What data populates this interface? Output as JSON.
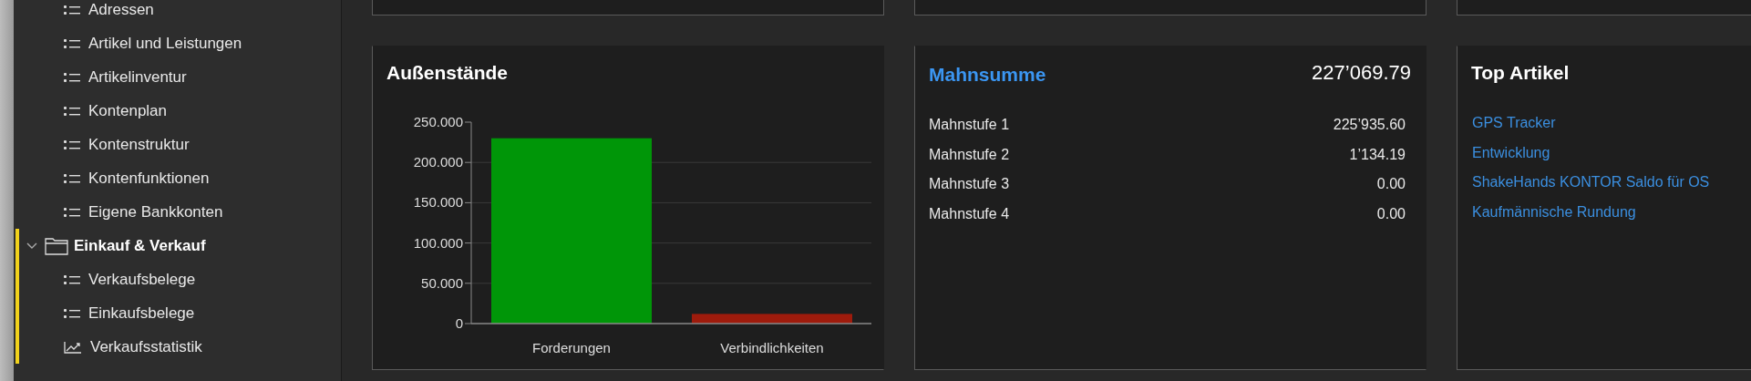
{
  "sidebar": {
    "items": [
      {
        "kind": "list",
        "label": "Adressen",
        "selected": false
      },
      {
        "kind": "list",
        "label": "Artikel und Leistungen",
        "selected": false
      },
      {
        "kind": "list",
        "label": "Artikelinventur",
        "selected": false
      },
      {
        "kind": "list",
        "label": "Kontenplan",
        "selected": false
      },
      {
        "kind": "list",
        "label": "Kontenstruktur",
        "selected": false
      },
      {
        "kind": "list",
        "label": "Kontenfunktionen",
        "selected": false
      },
      {
        "kind": "list",
        "label": "Eigene Bankkonten",
        "selected": false
      },
      {
        "kind": "folder",
        "label": "Einkauf & Verkauf",
        "selected": true,
        "expanded": true,
        "children": [
          {
            "kind": "list",
            "label": "Verkaufsbelege",
            "selected": false
          },
          {
            "kind": "list",
            "label": "Einkaufsbelege",
            "selected": false
          },
          {
            "kind": "chart",
            "label": "Verkaufsstatistik",
            "selected": false
          }
        ]
      }
    ]
  },
  "outstanding": {
    "title": "Außenstände",
    "chart_data": {
      "type": "bar",
      "categories": [
        "Forderungen",
        "Verbindlichkeiten"
      ],
      "series": [
        {
          "color": "#009608",
          "values": [
            230,
            null
          ]
        },
        {
          "color": "#9e1b0c",
          "values": [
            null,
            12
          ]
        }
      ],
      "grid": true,
      "ylim": [
        0,
        250
      ],
      "yticks": [
        {
          "value": 0,
          "label": "0"
        },
        {
          "value": 50,
          "label": "50.000"
        },
        {
          "value": 100,
          "label": "100.000"
        },
        {
          "value": 150,
          "label": "150.000"
        },
        {
          "value": 200,
          "label": "200.000"
        },
        {
          "value": 250,
          "label": "250.000"
        }
      ]
    }
  },
  "dunning": {
    "title": "Mahnsumme",
    "total": "227’069.79",
    "rows": [
      {
        "label": "Mahnstufe 1",
        "value": "225’935.60"
      },
      {
        "label": "Mahnstufe 2",
        "value": "1’134.19"
      },
      {
        "label": "Mahnstufe 3",
        "value": "0.00"
      },
      {
        "label": "Mahnstufe 4",
        "value": "0.00"
      }
    ]
  },
  "top_articles": {
    "title": "Top Artikel",
    "items": [
      "GPS Tracker",
      "Entwicklung",
      "ShakeHands KONTOR Saldo für OS",
      "Kaufmännische Rundung"
    ]
  }
}
